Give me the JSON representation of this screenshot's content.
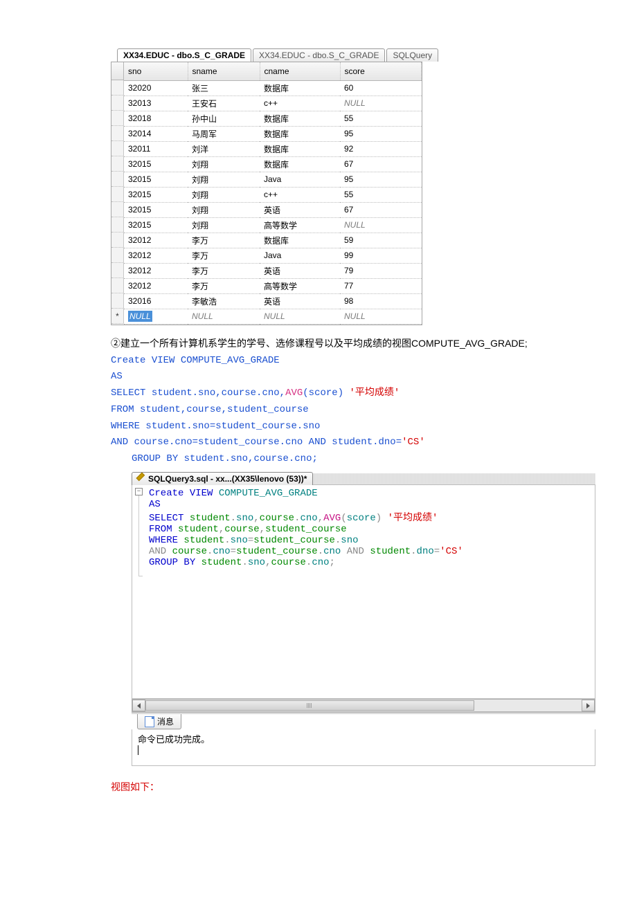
{
  "tabs": {
    "t1": "XX34.EDUC - dbo.S_C_GRADE",
    "t2": "XX34.EDUC - dbo.S_C_GRADE",
    "t3": "SQLQuery"
  },
  "grid": {
    "headers": {
      "c1": "sno",
      "c2": "sname",
      "c3": "cname",
      "c4": "score"
    },
    "rows": [
      {
        "c1": "32020",
        "c2": "张三",
        "c3": "数据库",
        "c4": "60"
      },
      {
        "c1": "32013",
        "c2": "王安石",
        "c3": "c++",
        "c4": "NULL",
        "null4": true
      },
      {
        "c1": "32018",
        "c2": "孙中山",
        "c3": "数据库",
        "c4": "55"
      },
      {
        "c1": "32014",
        "c2": "马周军",
        "c3": "数据库",
        "c4": "95"
      },
      {
        "c1": "32011",
        "c2": "刘洋",
        "c3": "数据库",
        "c4": "92"
      },
      {
        "c1": "32015",
        "c2": "刘翔",
        "c3": "数据库",
        "c4": "67"
      },
      {
        "c1": "32015",
        "c2": "刘翔",
        "c3": "Java",
        "c4": "95"
      },
      {
        "c1": "32015",
        "c2": "刘翔",
        "c3": "c++",
        "c4": "55"
      },
      {
        "c1": "32015",
        "c2": "刘翔",
        "c3": "英语",
        "c4": "67"
      },
      {
        "c1": "32015",
        "c2": "刘翔",
        "c3": "高等数学",
        "c4": "NULL",
        "null4": true
      },
      {
        "c1": "32012",
        "c2": "李万",
        "c3": "数据库",
        "c4": "59"
      },
      {
        "c1": "32012",
        "c2": "李万",
        "c3": "Java",
        "c4": "99"
      },
      {
        "c1": "32012",
        "c2": "李万",
        "c3": "英语",
        "c4": "79"
      },
      {
        "c1": "32012",
        "c2": "李万",
        "c3": "高等数学",
        "c4": "77"
      },
      {
        "c1": "32016",
        "c2": "李敏浩",
        "c3": "英语",
        "c4": "98"
      },
      {
        "c1": "NULL",
        "c2": "NULL",
        "c3": "NULL",
        "c4": "NULL",
        "allnull": true
      }
    ]
  },
  "task": "②建立一个所有计算机系学生的学号、选修课程号以及平均成绩的视图COMPUTE_AVG_GRADE;",
  "sql1": {
    "l1a": "Create",
    "l1b": " VIEW COMPUTE_AVG_GRADE",
    "l2": "AS",
    "l3a": "SELECT",
    "l3b": " student.sno,course.cno,",
    "l3c": "AVG",
    "l3d": "(score) ",
    "l3e": "'平均成绩'",
    "l4a": "FROM",
    "l4b": " student,course,student_course",
    "l5a": "WHERE",
    "l5b": " student.sno=student_course.sno",
    "l6a": "AND",
    "l6b": " course.cno=student_course.cno ",
    "l6c": "AND",
    "l6d": " student.dno=",
    "l6e": "'CS'",
    "l7a": "GROUP",
    "l7b": " BY",
    "l7c": " student.sno,course.cno;"
  },
  "ssms_tab": "SQLQuery3.sql - xx...(XX35\\lenovo (53))*",
  "editor": {
    "l1a": "Create",
    "l1b": " VIEW",
    "l1c": " COMPUTE_AVG_GRADE",
    "l2": "AS",
    "l3a": "SELECT",
    "l3b": " student",
    "l3c": ".",
    "l3d": "sno",
    "l3e": ",",
    "l3f": "course",
    "l3g": ".",
    "l3h": "cno",
    "l3i": ",",
    "l3j": "AVG",
    "l3k": "(",
    "l3l": "score",
    "l3m": ")",
    "l3n": " '平均成绩'",
    "l4a": "FROM",
    "l4b": " student",
    "l4c": ",",
    "l4d": "course",
    "l4e": ",",
    "l4f": "student_course",
    "l5a": "WHERE",
    "l5b": " student",
    "l5c": ".",
    "l5d": "sno",
    "l5e": "=",
    "l5f": "student_course",
    "l5g": ".",
    "l5h": "sno",
    "l6a": "AND",
    "l6b": " course",
    "l6c": ".",
    "l6d": "cno",
    "l6e": "=",
    "l6f": "student_course",
    "l6g": ".",
    "l6h": "cno ",
    "l6i": "AND",
    "l6j": " student",
    "l6k": ".",
    "l6l": "dno",
    "l6m": "=",
    "l6n": "'CS'",
    "l7a": "GROUP",
    "l7b": " BY",
    "l7c": " student",
    "l7d": ".",
    "l7e": "sno",
    "l7f": ",",
    "l7g": "course",
    "l7h": ".",
    "l7i": "cno",
    "l7j": ";"
  },
  "msg_tab": "消息",
  "msg_body": "命令已成功完成。",
  "footer": "视图如下："
}
